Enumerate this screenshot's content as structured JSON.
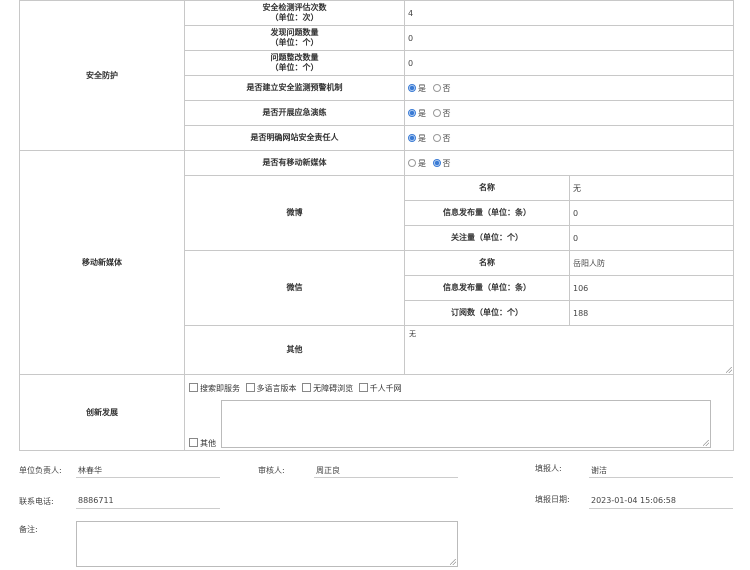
{
  "security": {
    "section_label": "安全防护",
    "eval_count": {
      "label_l1": "安全检测评估次数",
      "label_l2": "（单位：次）",
      "value": "4"
    },
    "issues_found": {
      "label_l1": "发现问题数量",
      "label_l2": "（单位：个）",
      "value": "0"
    },
    "issues_fixed": {
      "label_l1": "问题整改数量",
      "label_l2": "（单位：个）",
      "value": "0"
    },
    "monitoring": {
      "label": "是否建立安全监测预警机制",
      "selected": "是"
    },
    "drill": {
      "label": "是否开展应急演练",
      "selected": "是"
    },
    "owner": {
      "label": "是否明确网站安全责任人",
      "selected": "是"
    },
    "yes": "是",
    "no": "否"
  },
  "media": {
    "section_label": "移动新媒体",
    "has_media": {
      "label": "是否有移动新媒体",
      "selected": "否"
    },
    "weibo": {
      "label": "微博",
      "name_label": "名称",
      "name_value": "无",
      "posts_label": "信息发布量（单位：条）",
      "posts_value": "0",
      "follow_label": "关注量（单位：个）",
      "follow_value": "0"
    },
    "wechat": {
      "label": "微信",
      "name_label": "名称",
      "name_value": "岳阳人防",
      "posts_label": "信息发布量（单位：条）",
      "posts_value": "106",
      "subs_label": "订阅数（单位：个）",
      "subs_value": "188"
    },
    "other": {
      "label": "其他",
      "value": "无"
    }
  },
  "innovation": {
    "section_label": "创新发展",
    "options": [
      "搜索即服务",
      "多语言版本",
      "无障碍浏览",
      "千人千网"
    ],
    "other_label": "其他"
  },
  "footer": {
    "unit_head_label": "单位负责人:",
    "unit_head_value": "林春华",
    "reviewer_label": "审核人:",
    "reviewer_value": "周正良",
    "filler_label": "填报人:",
    "filler_value": "谢洁",
    "phone_label": "联系电话:",
    "phone_value": "8886711",
    "date_label": "填报日期:",
    "date_value": "2023-01-04 15:06:58",
    "remark_label": "备注:"
  }
}
